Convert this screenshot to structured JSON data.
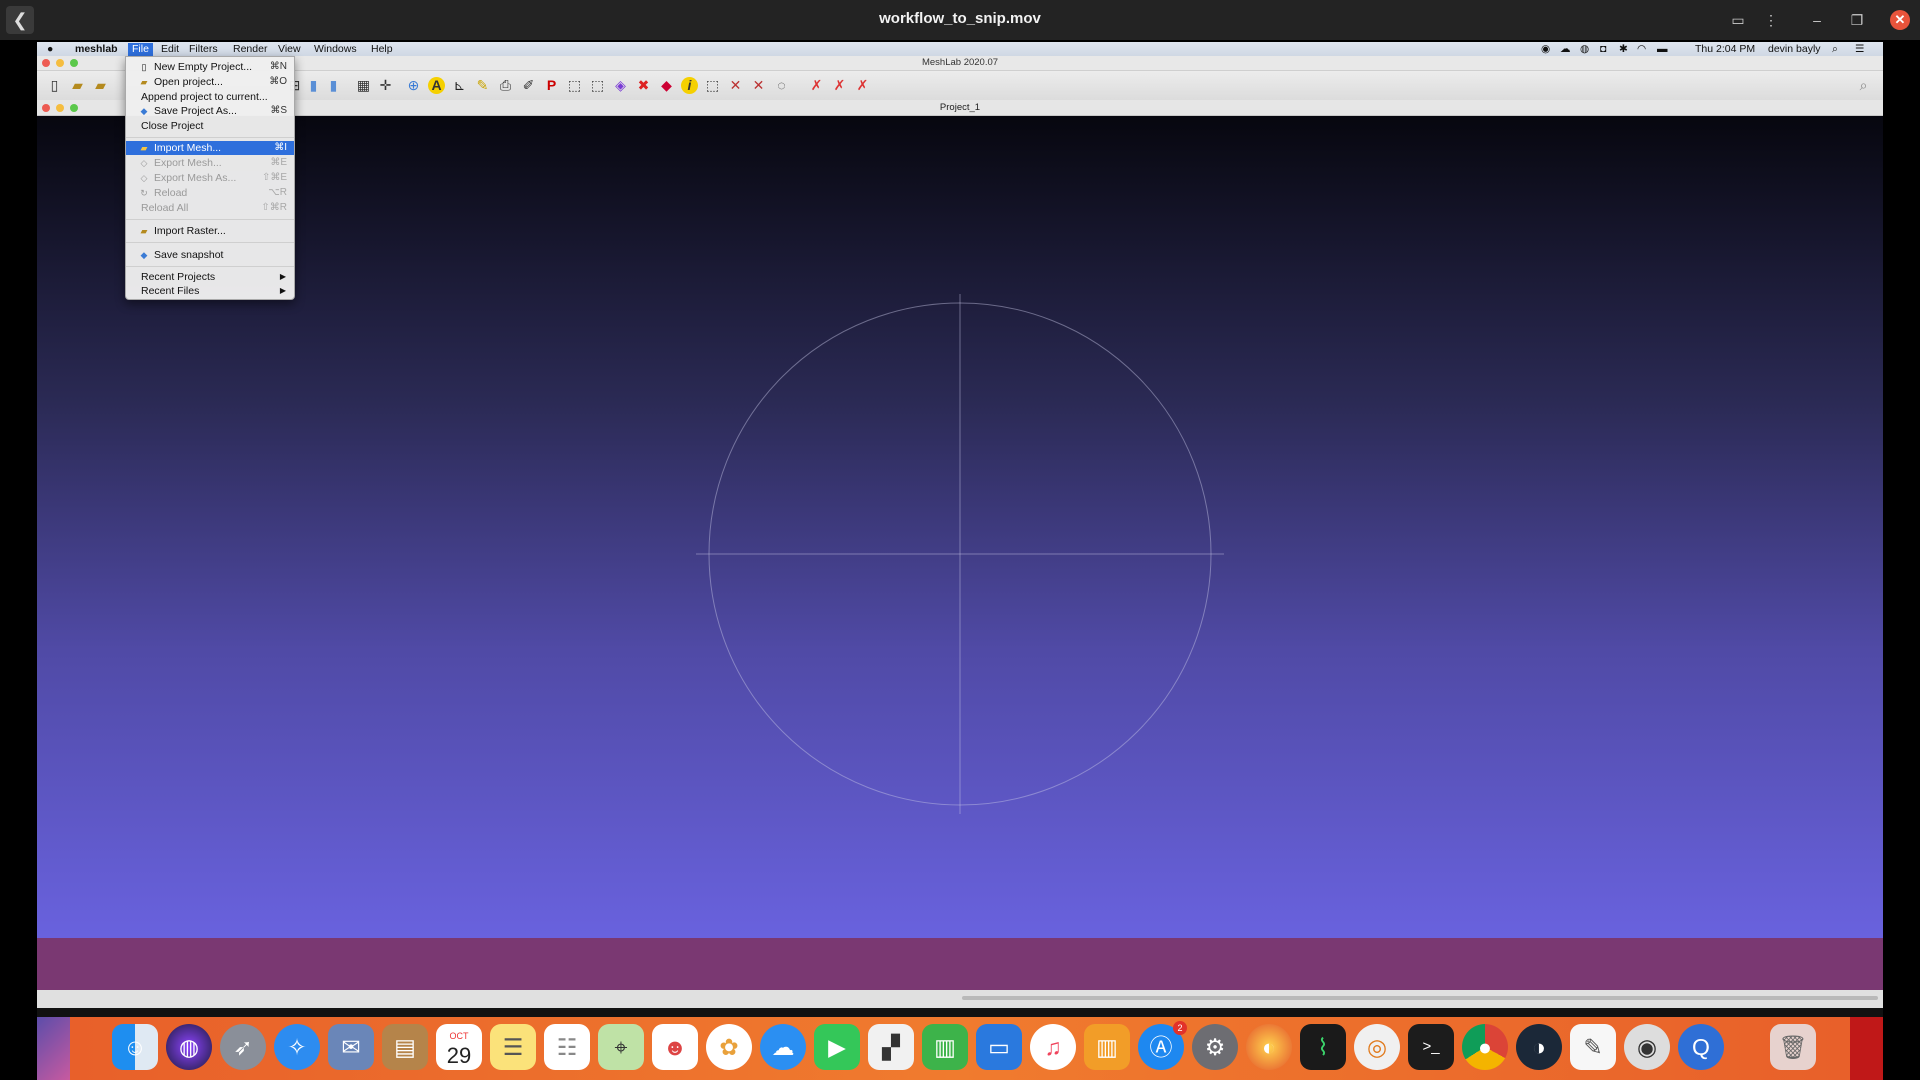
{
  "player": {
    "title": "workflow_to_snip.mov",
    "back_icon": "chevron-left-icon",
    "controls": [
      "cast-icon",
      "more-icon",
      "minimize-icon",
      "restore-icon"
    ],
    "close_icon": "close-icon"
  },
  "menubar": {
    "apple": "",
    "app": "meshlab",
    "items": [
      "File",
      "Edit",
      "Filters",
      "Render",
      "View",
      "Windows",
      "Help"
    ],
    "active": "File",
    "clock": "Thu 2:04 PM",
    "user": "devin bayly"
  },
  "window": {
    "title": "MeshLab 2020.07",
    "document_title": "Project_1"
  },
  "file_menu": {
    "items": [
      {
        "label": "New Empty Project...",
        "shortcut": "⌘N",
        "icon": "document-icon",
        "state": "normal"
      },
      {
        "label": "Open project...",
        "shortcut": "⌘O",
        "icon": "folder-icon",
        "state": "normal"
      },
      {
        "label": "Append project to current...",
        "shortcut": "",
        "icon": "",
        "state": "normal"
      },
      {
        "label": "Save Project As...",
        "shortcut": "⌘S",
        "icon": "save-icon",
        "state": "normal"
      },
      {
        "label": "Close Project",
        "shortcut": "",
        "icon": "",
        "state": "normal"
      },
      {
        "label": "Import Mesh...",
        "shortcut": "⌘I",
        "icon": "folder-icon",
        "state": "selected"
      },
      {
        "label": "Export Mesh...",
        "shortcut": "⌘E",
        "icon": "export-icon",
        "state": "disabled"
      },
      {
        "label": "Export Mesh As...",
        "shortcut": "⇧⌘E",
        "icon": "export-icon",
        "state": "disabled"
      },
      {
        "label": "Reload",
        "shortcut": "⌥R",
        "icon": "reload-icon",
        "state": "disabled"
      },
      {
        "label": "Reload All",
        "shortcut": "⇧⌘R",
        "icon": "",
        "state": "disabled"
      },
      {
        "label": "Import Raster...",
        "shortcut": "",
        "icon": "folder-icon",
        "state": "normal"
      },
      {
        "label": "Save snapshot",
        "shortcut": "",
        "icon": "snapshot-icon",
        "state": "normal"
      },
      {
        "label": "Recent Projects",
        "shortcut": "",
        "icon": "",
        "state": "submenu"
      },
      {
        "label": "Recent Files",
        "shortcut": "",
        "icon": "",
        "state": "submenu"
      }
    ]
  },
  "dock": {
    "calendar_month": "OCT",
    "calendar_day": "29",
    "app_store_badge": "2"
  }
}
